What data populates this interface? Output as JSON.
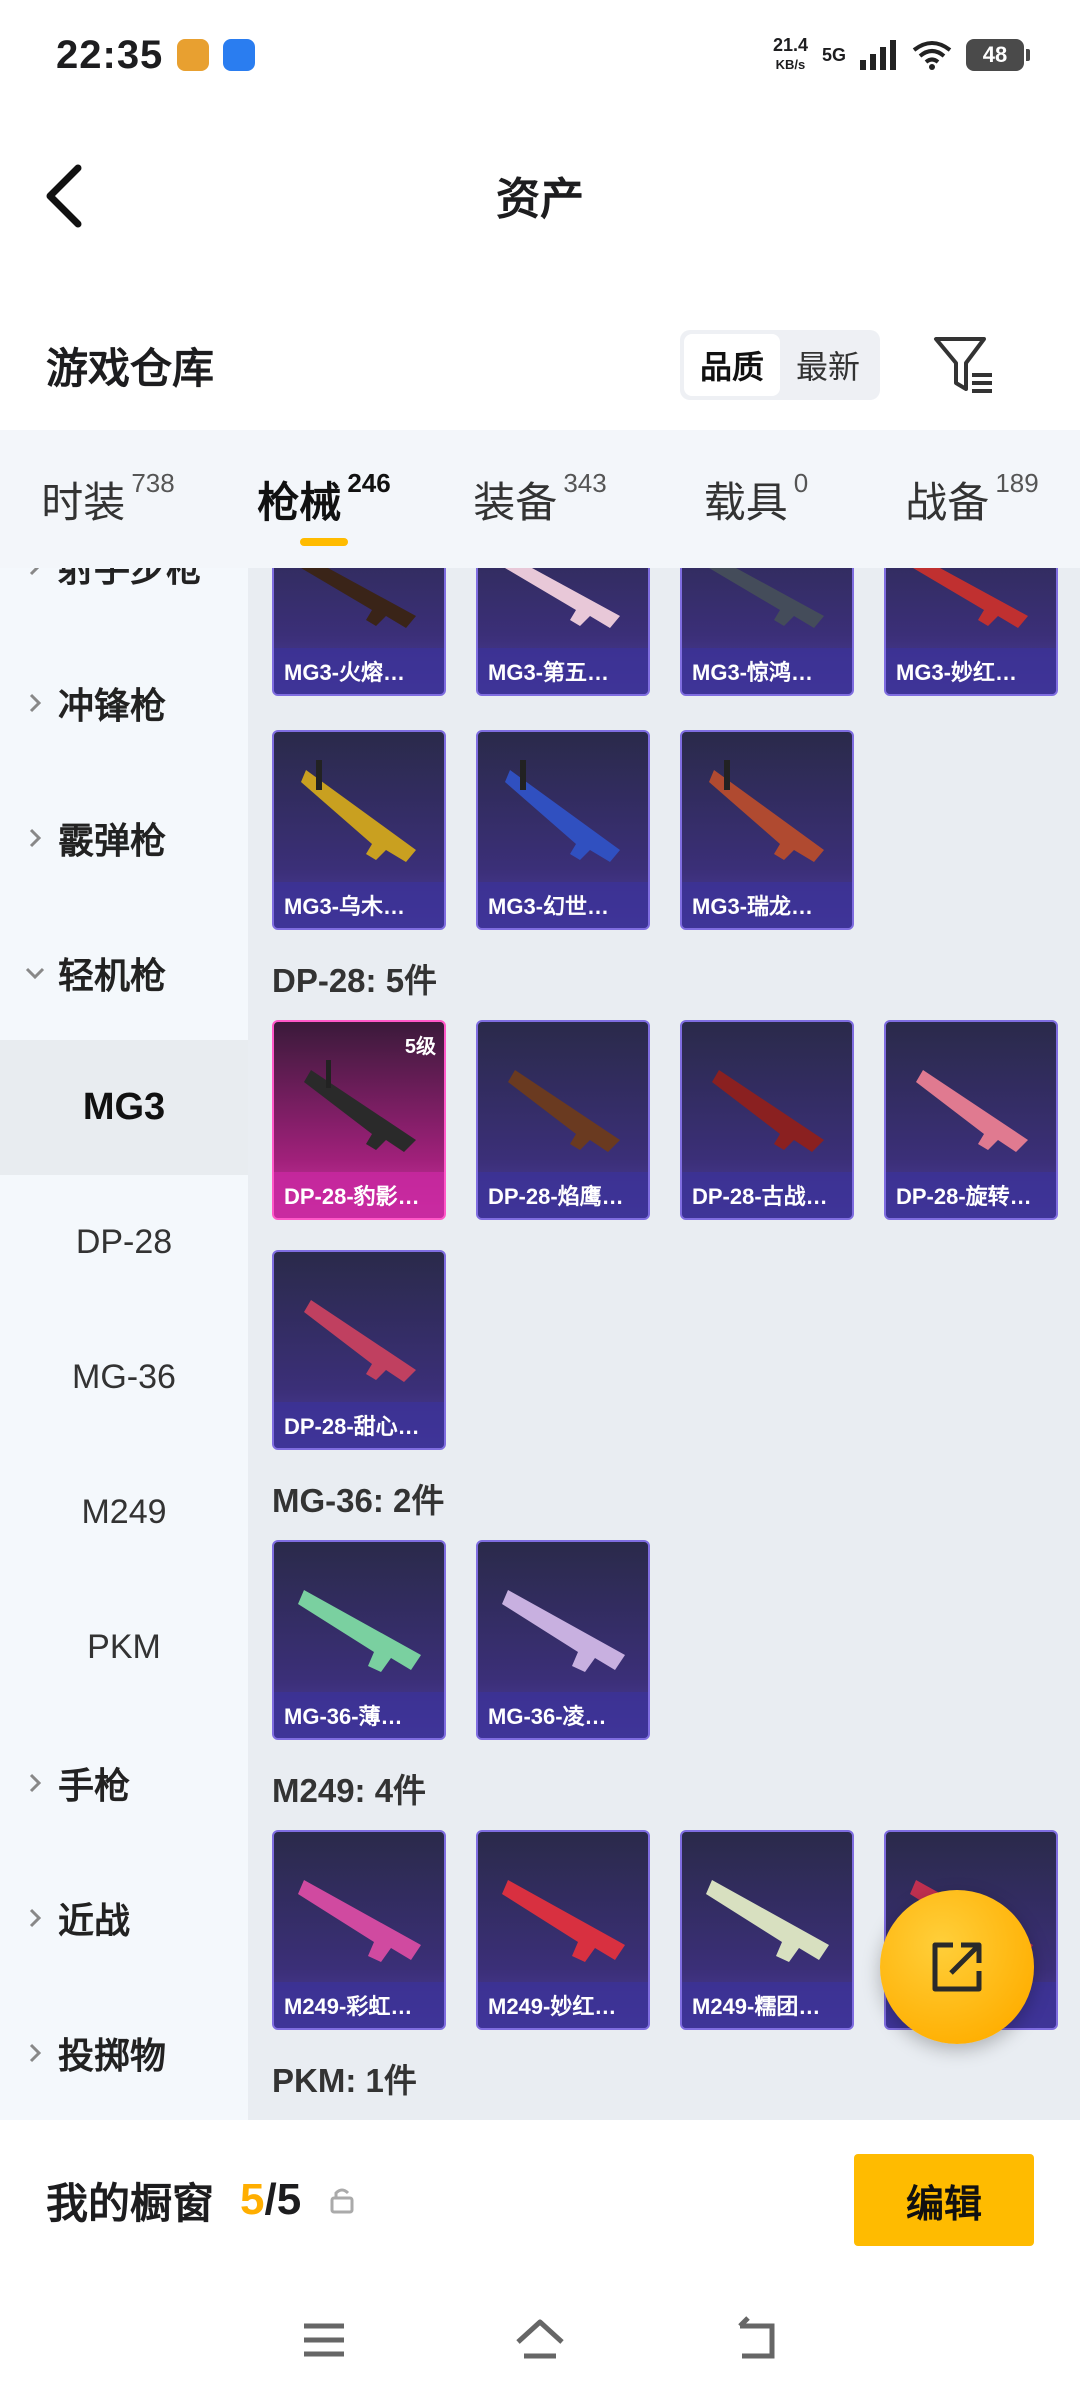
{
  "status": {
    "time": "22:35",
    "net_speed": "21.4",
    "net_unit": "KB/s",
    "network": "5G",
    "battery": "48"
  },
  "header": {
    "title": "资产"
  },
  "warehouse": {
    "title": "游戏仓库",
    "sort_options": [
      "品质",
      "最新"
    ],
    "active_sort": "品质"
  },
  "tabs": [
    {
      "label": "时装",
      "count": "738"
    },
    {
      "label": "枪械",
      "count": "246",
      "active": true
    },
    {
      "label": "装备",
      "count": "343"
    },
    {
      "label": "载具",
      "count": "0"
    },
    {
      "label": "战备",
      "count": "189"
    }
  ],
  "sidebar": {
    "partial_top": "射手步枪",
    "categories": [
      "冲锋枪",
      "霰弹枪",
      "轻机枪"
    ],
    "subitems": [
      "MG3",
      "DP-28",
      "MG-36",
      "M249",
      "PKM"
    ],
    "active_sub": "MG3",
    "more_categories": [
      "手枪",
      "近战",
      "投掷物"
    ]
  },
  "sections": {
    "mg3_top_row": [
      "MG3-火熔…",
      "MG3-第五…",
      "MG3-惊鸿…",
      "MG3-妙红…"
    ],
    "mg3_row2": [
      "MG3-乌木…",
      "MG3-幻世…",
      "MG3-瑞龙…"
    ],
    "dp28_title": "DP-28: 5件",
    "dp28_items": [
      "DP-28-豹影…",
      "DP-28-焰鹰…",
      "DP-28-古战…",
      "DP-28-旋转…",
      "DP-28-甜心…"
    ],
    "dp28_level": "5级",
    "mg36_title": "MG-36: 2件",
    "mg36_items": [
      "MG-36-薄…",
      "MG-36-凌…"
    ],
    "m249_title": "M249: 4件",
    "m249_items": [
      "M249-彩虹…",
      "M249-妙红…",
      "M249-糯团…",
      "…"
    ],
    "pkm_title": "PKM: 1件"
  },
  "showcase": {
    "label": "我的橱窗",
    "current": "5",
    "total": "/5",
    "edit": "编辑"
  },
  "colors": {
    "accent": "#ffbb00",
    "card_purple": "#3b2f78",
    "card_gold": "#d23aa8"
  }
}
